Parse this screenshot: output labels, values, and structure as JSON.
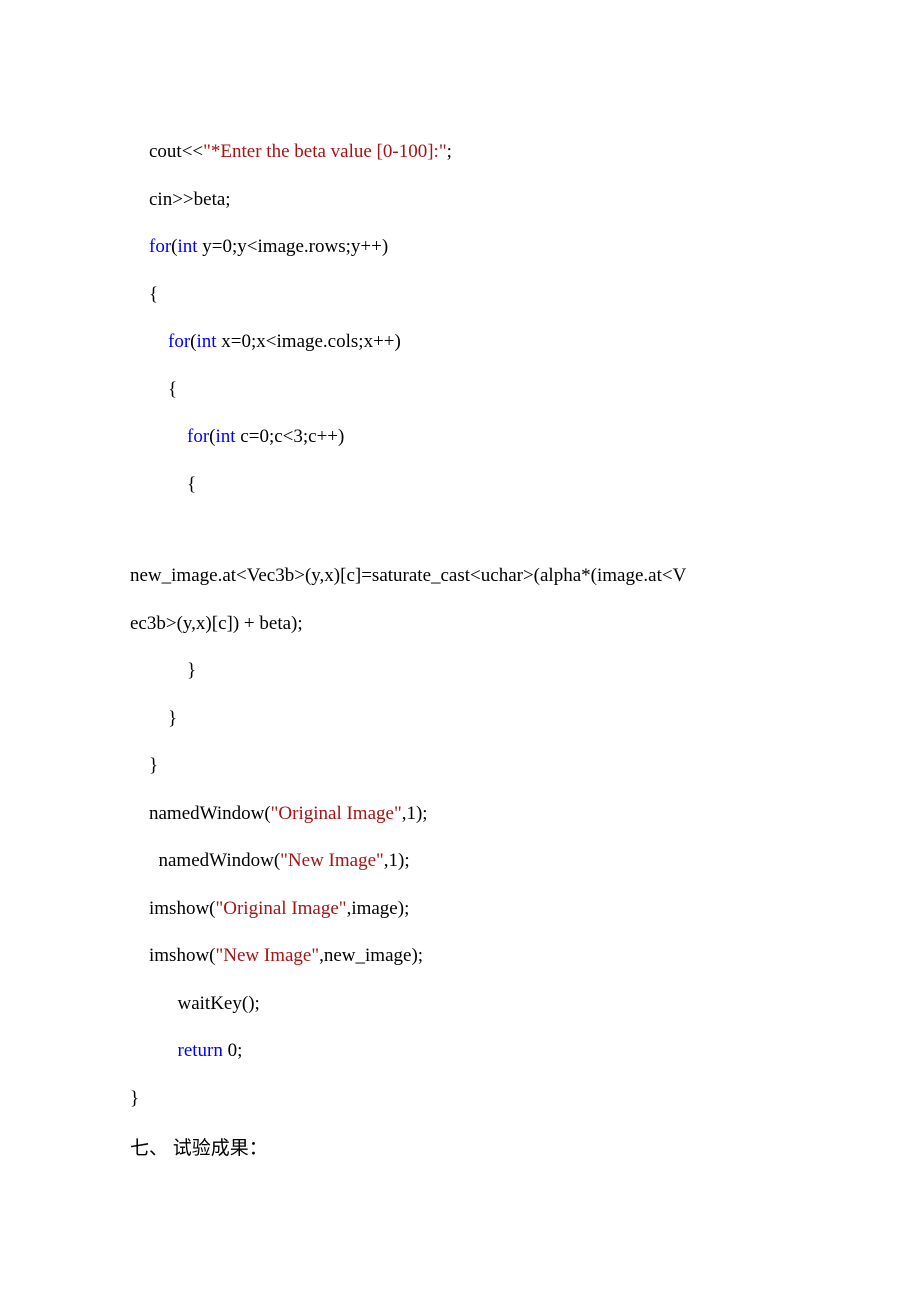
{
  "lines": {
    "l1_pre": "    cout<<",
    "l1_str": "\"*Enter the beta value [0-100]:\"",
    "l1_post": ";",
    "l2": "    cin>>beta;",
    "l3_pre": "    ",
    "l3_kw1": "for",
    "l3_mid1": "(",
    "l3_kw2": "int",
    "l3_post": " y=0;y<image.rows;y++)",
    "l4": "    {",
    "l5_pre": "        ",
    "l5_kw1": "for",
    "l5_mid1": "(",
    "l5_kw2": "int",
    "l5_post": " x=0;x<image.cols;x++)",
    "l6": "        {",
    "l7_pre": "            ",
    "l7_kw1": "for",
    "l7_mid1": "(",
    "l7_kw2": "int",
    "l7_post": " c=0;c<3;c++)",
    "l8": "            {",
    "l9": "new_image.at<Vec3b>(y,x)[c]=saturate_cast<uchar>(alpha*(image.at<V",
    "l10": "ec3b>(y,x)[c]) + beta);",
    "l11": "            }",
    "l12": "        }",
    "l13": "    }",
    "l14_pre": "    namedWindow(",
    "l14_str": "\"Original Image\"",
    "l14_post": ",1);",
    "l15_pre": "      namedWindow(",
    "l15_str": "\"New Image\"",
    "l15_post": ",1);",
    "l16_pre": "    imshow(",
    "l16_str": "\"Original Image\"",
    "l16_post": ",image);",
    "l17_pre": "    imshow(",
    "l17_str": "\"New Image\"",
    "l17_post": ",new_image);",
    "l18": "          waitKey();",
    "l19_pre": "          ",
    "l19_kw": "return",
    "l19_post": " 0;",
    "l20": "}"
  },
  "heading": "七、 试验成果："
}
